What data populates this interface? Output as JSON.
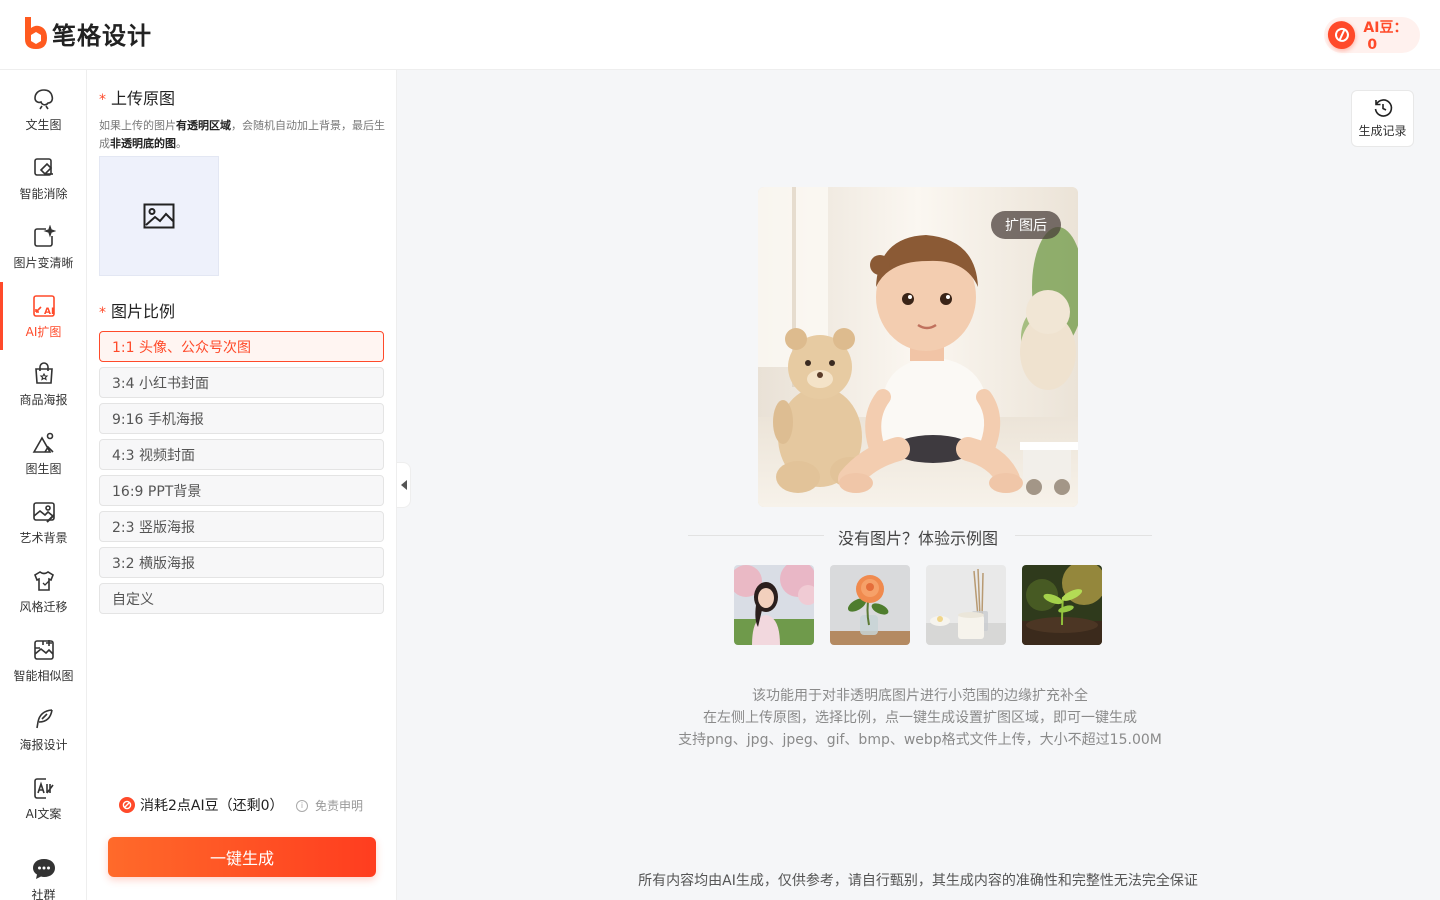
{
  "app": {
    "brand": "笔格设计",
    "aidou_label": "AI豆：",
    "aidou_value": "0",
    "accent_color": "#ff4a2a"
  },
  "nav": {
    "items": [
      {
        "label": "文生图",
        "icon": "text-to-image-icon"
      },
      {
        "label": "智能消除",
        "icon": "smart-erase-icon"
      },
      {
        "label": "图片变清晰",
        "icon": "image-enhance-icon"
      },
      {
        "label": "AI扩图",
        "icon": "ai-expand-icon",
        "active": true
      },
      {
        "label": "商品海报",
        "icon": "product-poster-icon"
      },
      {
        "label": "图生图",
        "icon": "image-to-image-icon"
      },
      {
        "label": "艺术背景",
        "icon": "art-background-icon"
      },
      {
        "label": "风格迁移",
        "icon": "style-transfer-icon"
      },
      {
        "label": "智能相似图",
        "icon": "similar-image-icon"
      },
      {
        "label": "海报设计",
        "icon": "poster-design-icon"
      },
      {
        "label": "AI文案",
        "icon": "ai-copywriting-icon"
      }
    ],
    "community": "社群"
  },
  "panel": {
    "required_mark": "*",
    "upload_title": "上传原图",
    "tip_part1": "如果上传的图片",
    "tip_bold1": "有透明区域",
    "tip_part2": "，会随机自动加上背景，最后生成",
    "tip_bold2": "非透明底的图",
    "tip_part3": "。",
    "ratio_title": "图片比例",
    "ratios": [
      {
        "label": "1:1 头像、公众号次图",
        "active": true
      },
      {
        "label": "3:4 小红书封面"
      },
      {
        "label": "9:16 手机海报"
      },
      {
        "label": "4:3 视频封面"
      },
      {
        "label": "16:9 PPT背景"
      },
      {
        "label": "2:3 竖版海报"
      },
      {
        "label": "3:2 横版海报"
      },
      {
        "label": "自定义"
      }
    ],
    "cost_text": "消耗2点AI豆（还剩0）",
    "disclaimer": "免责申明",
    "generate_label": "一键生成"
  },
  "main": {
    "history_label": "生成记录",
    "preview_badge": "扩图后",
    "examples_title": "没有图片？体验示例图",
    "examples": [
      "portrait-woman-example",
      "rose-vase-example",
      "candle-diffuser-example",
      "sprout-soil-example"
    ],
    "desc_lines": [
      "该功能用于对非透明底图片进行小范围的边缘扩充补全",
      "在左侧上传原图，选择比例，点一键生成设置扩图区域，即可一键生成",
      "支持png、jpg、jpeg、gif、bmp、webp格式文件上传，大小不超过15.00M"
    ],
    "footer_note": "所有内容均由AI生成，仅供参考，请自行甄别，其生成内容的准确性和完整性无法完全保证"
  }
}
